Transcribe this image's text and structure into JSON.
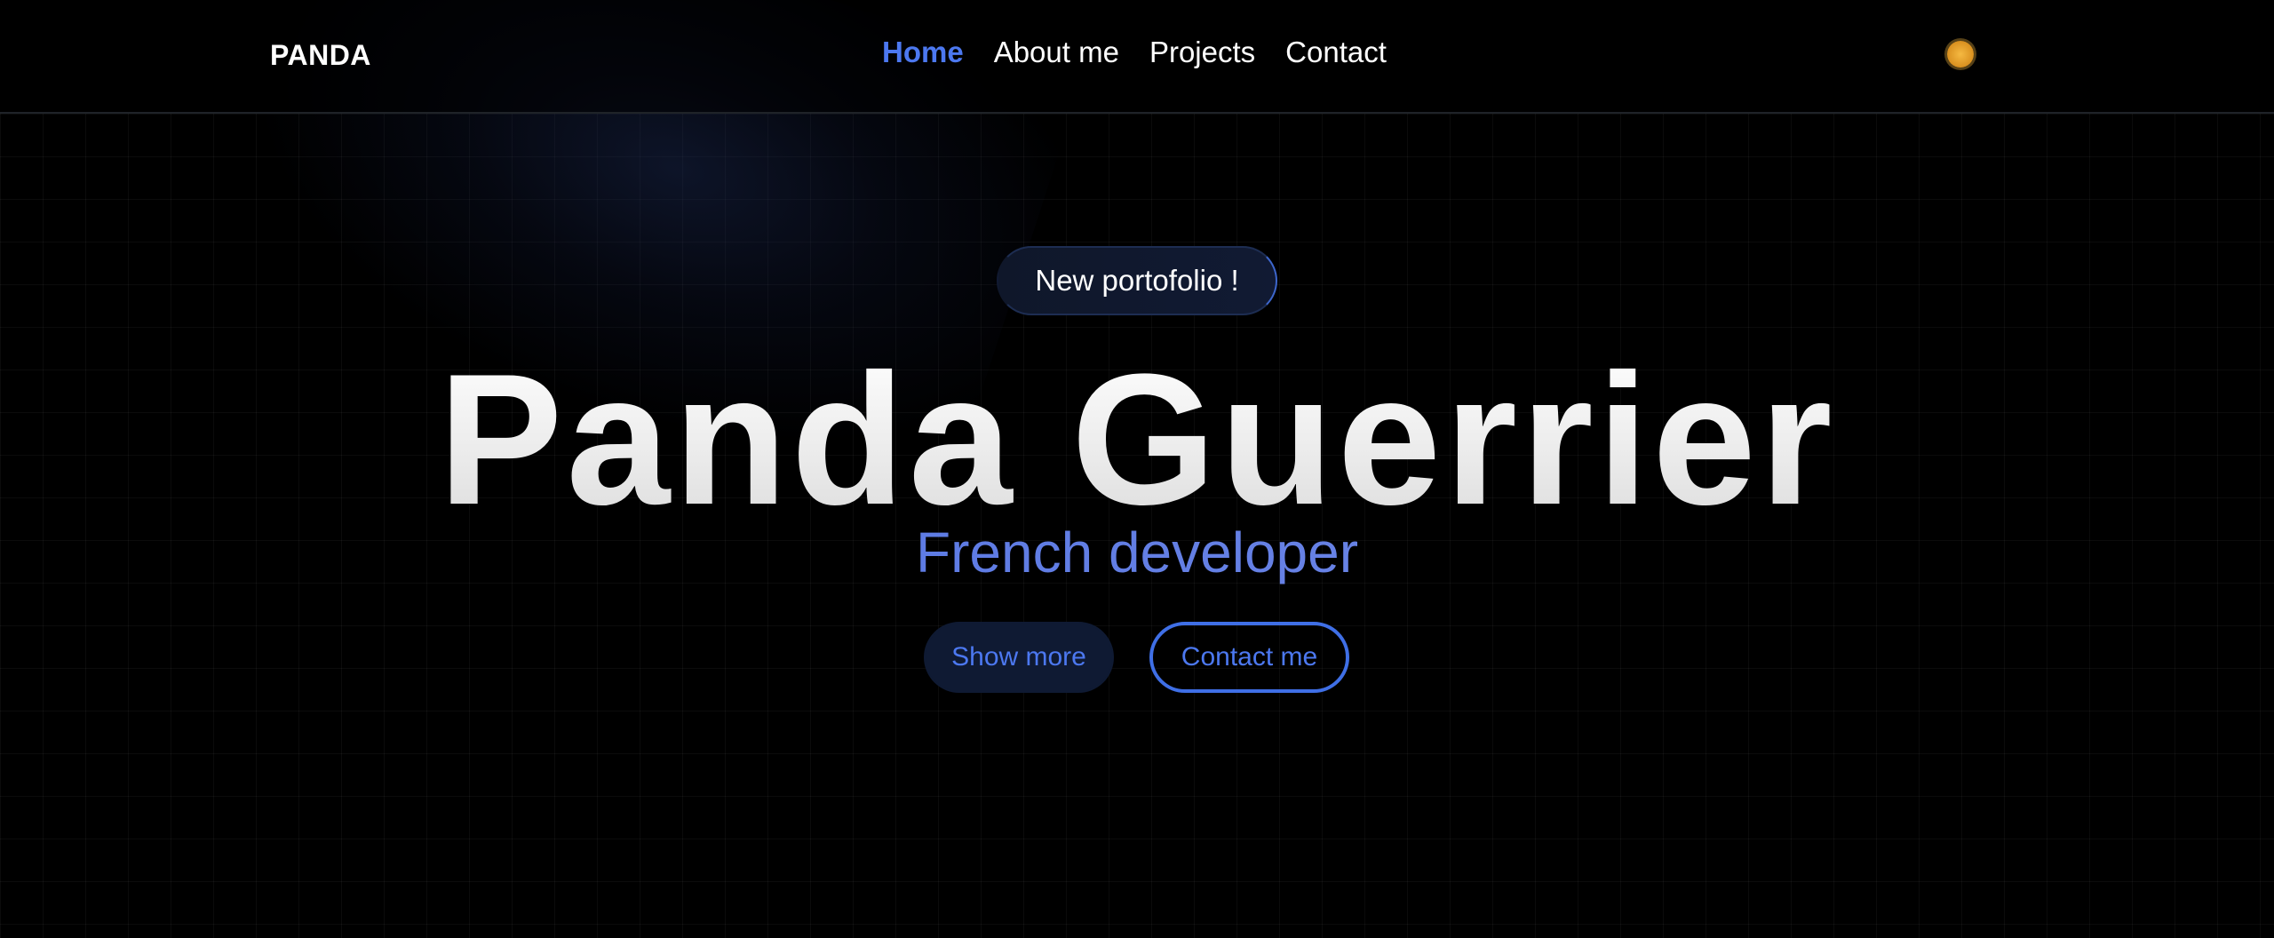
{
  "brand": {
    "logo_text": "PANDA"
  },
  "nav": {
    "items": [
      {
        "label": "Home",
        "active": true
      },
      {
        "label": "About me",
        "active": false
      },
      {
        "label": "Projects",
        "active": false
      },
      {
        "label": "Contact",
        "active": false
      }
    ],
    "theme_toggle_icon": "sun-icon"
  },
  "hero": {
    "badge": "New portofolio !",
    "title": "Panda Guerrier",
    "subtitle": "French developer",
    "show_more_label": "Show more",
    "contact_label": "Contact me"
  },
  "colors": {
    "background": "#000000",
    "accent": "#4c78f0",
    "title": "#f0f0f0",
    "sun": "#f5b942"
  }
}
